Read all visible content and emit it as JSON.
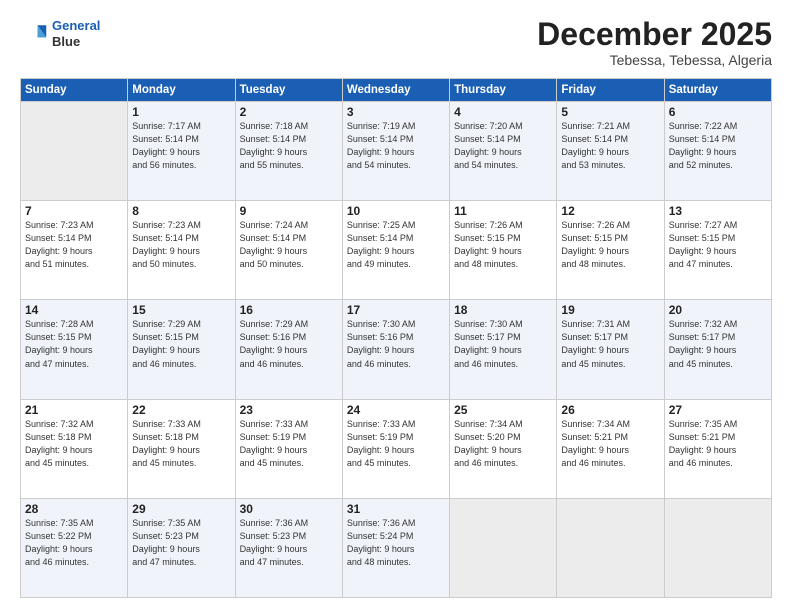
{
  "logo": {
    "line1": "General",
    "line2": "Blue"
  },
  "title": "December 2025",
  "subtitle": "Tebessa, Tebessa, Algeria",
  "days_header": [
    "Sunday",
    "Monday",
    "Tuesday",
    "Wednesday",
    "Thursday",
    "Friday",
    "Saturday"
  ],
  "weeks": [
    [
      {
        "day": "",
        "detail": ""
      },
      {
        "day": "1",
        "detail": "Sunrise: 7:17 AM\nSunset: 5:14 PM\nDaylight: 9 hours\nand 56 minutes."
      },
      {
        "day": "2",
        "detail": "Sunrise: 7:18 AM\nSunset: 5:14 PM\nDaylight: 9 hours\nand 55 minutes."
      },
      {
        "day": "3",
        "detail": "Sunrise: 7:19 AM\nSunset: 5:14 PM\nDaylight: 9 hours\nand 54 minutes."
      },
      {
        "day": "4",
        "detail": "Sunrise: 7:20 AM\nSunset: 5:14 PM\nDaylight: 9 hours\nand 54 minutes."
      },
      {
        "day": "5",
        "detail": "Sunrise: 7:21 AM\nSunset: 5:14 PM\nDaylight: 9 hours\nand 53 minutes."
      },
      {
        "day": "6",
        "detail": "Sunrise: 7:22 AM\nSunset: 5:14 PM\nDaylight: 9 hours\nand 52 minutes."
      }
    ],
    [
      {
        "day": "7",
        "detail": "Sunrise: 7:23 AM\nSunset: 5:14 PM\nDaylight: 9 hours\nand 51 minutes."
      },
      {
        "day": "8",
        "detail": "Sunrise: 7:23 AM\nSunset: 5:14 PM\nDaylight: 9 hours\nand 50 minutes."
      },
      {
        "day": "9",
        "detail": "Sunrise: 7:24 AM\nSunset: 5:14 PM\nDaylight: 9 hours\nand 50 minutes."
      },
      {
        "day": "10",
        "detail": "Sunrise: 7:25 AM\nSunset: 5:14 PM\nDaylight: 9 hours\nand 49 minutes."
      },
      {
        "day": "11",
        "detail": "Sunrise: 7:26 AM\nSunset: 5:15 PM\nDaylight: 9 hours\nand 48 minutes."
      },
      {
        "day": "12",
        "detail": "Sunrise: 7:26 AM\nSunset: 5:15 PM\nDaylight: 9 hours\nand 48 minutes."
      },
      {
        "day": "13",
        "detail": "Sunrise: 7:27 AM\nSunset: 5:15 PM\nDaylight: 9 hours\nand 47 minutes."
      }
    ],
    [
      {
        "day": "14",
        "detail": "Sunrise: 7:28 AM\nSunset: 5:15 PM\nDaylight: 9 hours\nand 47 minutes."
      },
      {
        "day": "15",
        "detail": "Sunrise: 7:29 AM\nSunset: 5:15 PM\nDaylight: 9 hours\nand 46 minutes."
      },
      {
        "day": "16",
        "detail": "Sunrise: 7:29 AM\nSunset: 5:16 PM\nDaylight: 9 hours\nand 46 minutes."
      },
      {
        "day": "17",
        "detail": "Sunrise: 7:30 AM\nSunset: 5:16 PM\nDaylight: 9 hours\nand 46 minutes."
      },
      {
        "day": "18",
        "detail": "Sunrise: 7:30 AM\nSunset: 5:17 PM\nDaylight: 9 hours\nand 46 minutes."
      },
      {
        "day": "19",
        "detail": "Sunrise: 7:31 AM\nSunset: 5:17 PM\nDaylight: 9 hours\nand 45 minutes."
      },
      {
        "day": "20",
        "detail": "Sunrise: 7:32 AM\nSunset: 5:17 PM\nDaylight: 9 hours\nand 45 minutes."
      }
    ],
    [
      {
        "day": "21",
        "detail": "Sunrise: 7:32 AM\nSunset: 5:18 PM\nDaylight: 9 hours\nand 45 minutes."
      },
      {
        "day": "22",
        "detail": "Sunrise: 7:33 AM\nSunset: 5:18 PM\nDaylight: 9 hours\nand 45 minutes."
      },
      {
        "day": "23",
        "detail": "Sunrise: 7:33 AM\nSunset: 5:19 PM\nDaylight: 9 hours\nand 45 minutes."
      },
      {
        "day": "24",
        "detail": "Sunrise: 7:33 AM\nSunset: 5:19 PM\nDaylight: 9 hours\nand 45 minutes."
      },
      {
        "day": "25",
        "detail": "Sunrise: 7:34 AM\nSunset: 5:20 PM\nDaylight: 9 hours\nand 46 minutes."
      },
      {
        "day": "26",
        "detail": "Sunrise: 7:34 AM\nSunset: 5:21 PM\nDaylight: 9 hours\nand 46 minutes."
      },
      {
        "day": "27",
        "detail": "Sunrise: 7:35 AM\nSunset: 5:21 PM\nDaylight: 9 hours\nand 46 minutes."
      }
    ],
    [
      {
        "day": "28",
        "detail": "Sunrise: 7:35 AM\nSunset: 5:22 PM\nDaylight: 9 hours\nand 46 minutes."
      },
      {
        "day": "29",
        "detail": "Sunrise: 7:35 AM\nSunset: 5:23 PM\nDaylight: 9 hours\nand 47 minutes."
      },
      {
        "day": "30",
        "detail": "Sunrise: 7:36 AM\nSunset: 5:23 PM\nDaylight: 9 hours\nand 47 minutes."
      },
      {
        "day": "31",
        "detail": "Sunrise: 7:36 AM\nSunset: 5:24 PM\nDaylight: 9 hours\nand 48 minutes."
      },
      {
        "day": "",
        "detail": ""
      },
      {
        "day": "",
        "detail": ""
      },
      {
        "day": "",
        "detail": ""
      }
    ]
  ]
}
